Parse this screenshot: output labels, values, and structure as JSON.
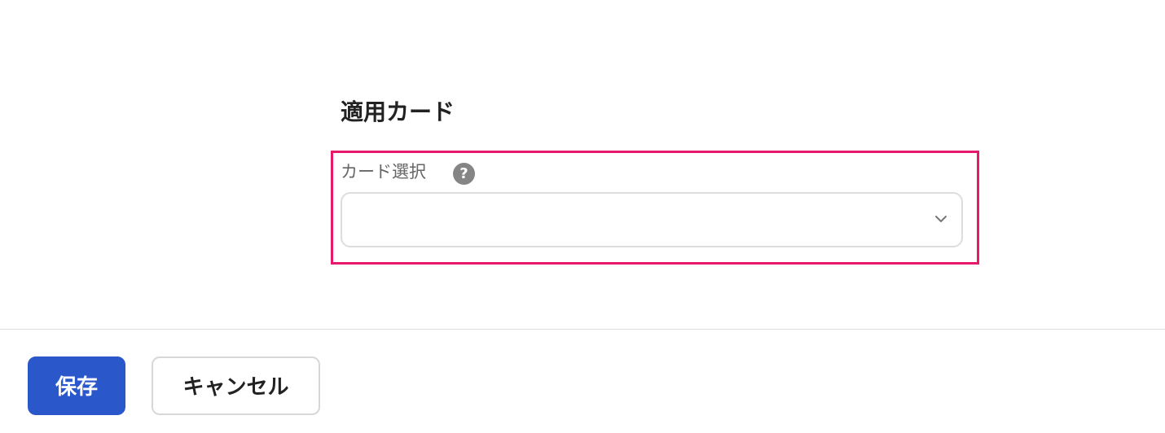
{
  "section": {
    "title": "適用カード"
  },
  "card_select": {
    "label": "カード選択",
    "help_icon": "question-circle-icon",
    "selected_value": "",
    "dropdown_icon": "chevron-down-icon"
  },
  "footer": {
    "save_label": "保存",
    "cancel_label": "キャンセル"
  },
  "colors": {
    "highlight_border": "#e8196a",
    "primary_button": "#2a57c9",
    "help_icon_bg": "#858585"
  }
}
